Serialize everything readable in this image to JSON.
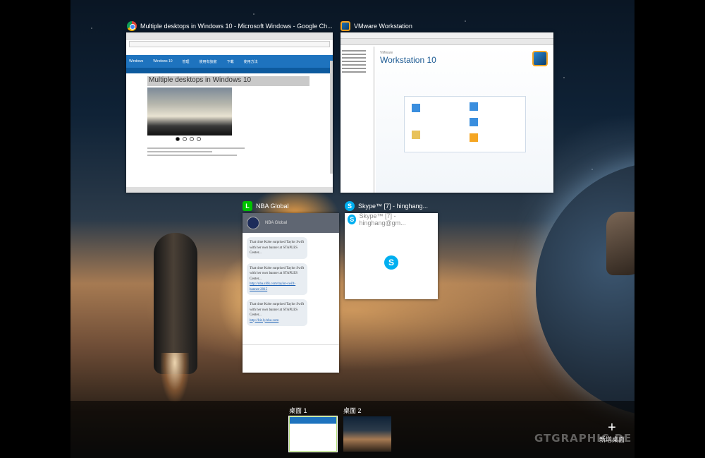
{
  "windows": {
    "chrome": {
      "title": "Multiple desktops in Windows 10 - Microsoft Windows - Google Ch...",
      "page": {
        "nav_logo": "Windows",
        "nav_items": [
          "Windows 10",
          "管理",
          "使用有訣竅",
          "下載",
          "使用方法"
        ],
        "heading": "Multiple desktops in Windows 10"
      }
    },
    "vmware": {
      "title": "VMware Workstation",
      "brand": "VMware",
      "product": "Workstation 10"
    },
    "line": {
      "title": "NBA Global",
      "messages": [
        {
          "text": "That time Kobe surprised Taylor Swift with her own banner at STAPLES Center...",
          "link": ""
        },
        {
          "text": "That time Kobe surprised Taylor Swift with her own banner at STAPLES Center...",
          "link": "http://nba.sfdk.com/taylor-swift-banner-2015"
        },
        {
          "text": "That time Kobe surprised Taylor Swift with her own banner at STAPLES Center...",
          "link": "http://bit.ly/nba-com"
        }
      ]
    },
    "skype": {
      "title": "Skype™ [7] - hinghang...",
      "inner_title": "Skype™ [7] - hinghang@gm..."
    }
  },
  "desktops": [
    {
      "label": "桌面 1",
      "active": true
    },
    {
      "label": "桌面 2",
      "active": false
    }
  ],
  "new_desktop": {
    "label": "新增桌面"
  },
  "watermark": "GTGRAPHIC.DE"
}
